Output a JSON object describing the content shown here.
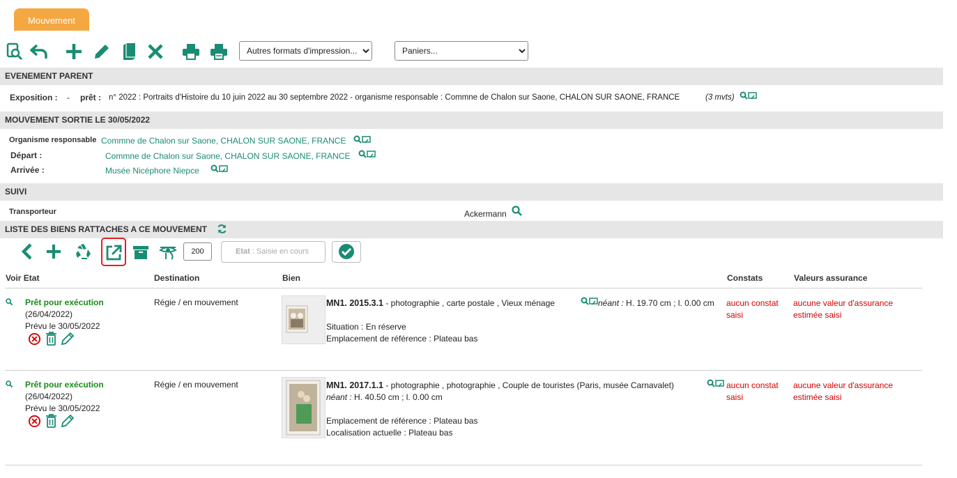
{
  "tab": {
    "label": "Mouvement"
  },
  "toolbar": {
    "print_formats_selected": "Autres formats d'impression...",
    "baskets_selected": "Paniers..."
  },
  "parent": {
    "header": "EVENEMENT PARENT",
    "exposition_label": "Exposition :",
    "exposition_value": "-",
    "pret_label": "prêt :",
    "pret_text": "n° 2022 : Portraits d'Histoire du 10 juin 2022 au 30 septembre 2022 - organisme responsable : Commne de Chalon sur Saone, CHALON SUR SAONE, FRANCE",
    "pret_count": "(3 mvts)"
  },
  "movement": {
    "header": "MOUVEMENT SORTIE LE 30/05/2022",
    "org_label": "Organisme responsable",
    "org_value": "Commne de Chalon sur Saone, CHALON SUR SAONE, FRANCE",
    "depart_label": "Départ :",
    "depart_value": "Commne de Chalon sur Saone, CHALON SUR SAONE, FRANCE",
    "arrivee_label": "Arrivée :",
    "arrivee_value": "Musée Nicéphore Niepce"
  },
  "suivi": {
    "header": "SUIVI",
    "transport_label": "Transporteur",
    "transport_value": "Ackermann"
  },
  "list": {
    "header": "LISTE DES BIENS RATTACHES A CE MOUVEMENT",
    "quantity": "200",
    "etat_label": "Etat",
    "etat_placeholder": " : Saisie en cours",
    "columns": {
      "voir_etat": "Voir Etat",
      "destination": "Destination",
      "bien": "Bien",
      "constats": "Constats",
      "valeurs": "Valeurs assurance"
    },
    "rows": [
      {
        "status": "Prêt pour exécution",
        "status_date": "(26/04/2022)",
        "planned": "Prévu le 30/05/2022",
        "destination": "Régie / en mouvement",
        "ref": "MN1. 2015.3.1",
        "desc": " - photographie , carte postale , Vieux ménage",
        "neant": "néant :",
        "dims": " H. 19.70 cm ;  l. 0.00 cm",
        "line2": "Situation : En réserve",
        "line3": "Emplacement de référence : Plateau bas",
        "constat": "aucun constat saisi",
        "valeur": "aucune valeur d'assurance estimée saisi"
      },
      {
        "status": "Prêt pour exécution",
        "status_date": "(26/04/2022)",
        "planned": "Prévu le 30/05/2022",
        "destination": "Régie / en mouvement",
        "ref": "MN1. 2017.1.1",
        "desc": " - photographie , photographie , Couple de touristes (Paris, musée Carnavalet)",
        "neant": "néant :",
        "dims": " H. 40.50 cm ;  l. 0.00 cm",
        "line2": "Emplacement de référence : Plateau bas",
        "line3": "Localisation actuelle : Plateau bas",
        "constat": "aucun constat saisi",
        "valeur": "aucune valeur d'assurance estimée saisi"
      }
    ]
  },
  "colors": {
    "accent": "#1a8c73",
    "tab": "#f5a742",
    "danger": "#d40000",
    "status": "#1a8c1a"
  }
}
